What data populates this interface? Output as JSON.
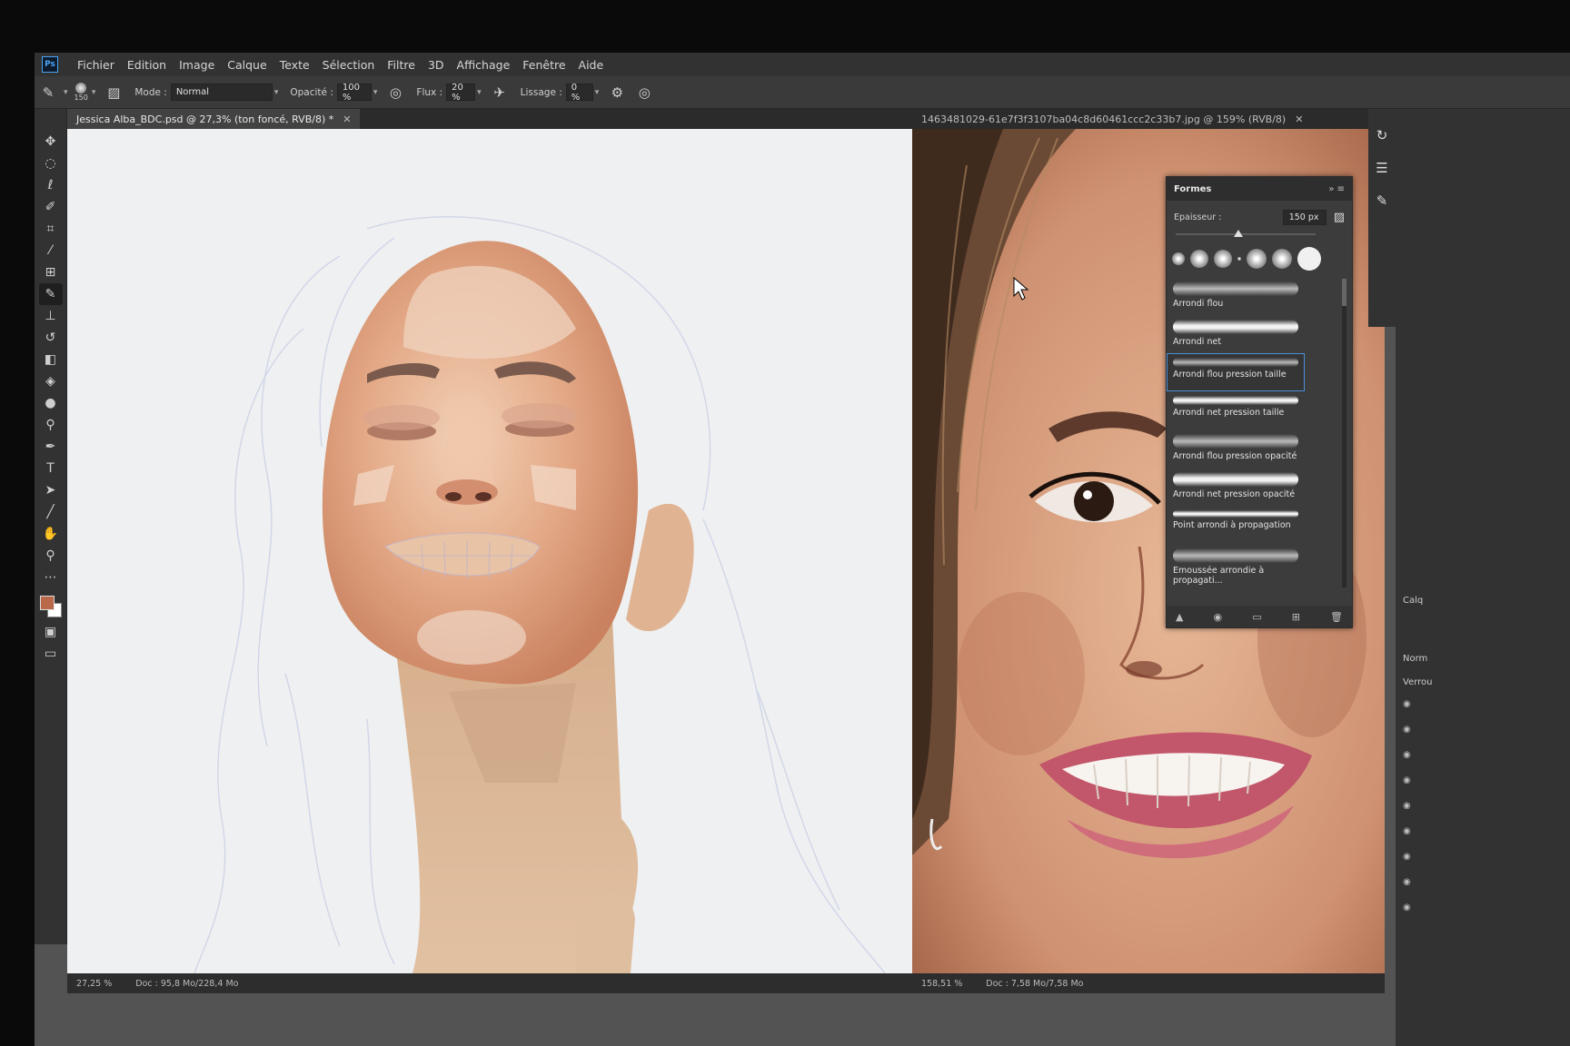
{
  "app": {
    "logo": "Ps",
    "menu": [
      "Fichier",
      "Edition",
      "Image",
      "Calque",
      "Texte",
      "Sélection",
      "Filtre",
      "3D",
      "Affichage",
      "Fenêtre",
      "Aide"
    ]
  },
  "options": {
    "brush_size": "150",
    "mode_label": "Mode :",
    "mode_value": "Normal",
    "opacity_label": "Opacité :",
    "opacity_value": "100 %",
    "flow_label": "Flux :",
    "flow_value": "20 %",
    "smoothing_label": "Lissage :",
    "smoothing_value": "0 %"
  },
  "docs": {
    "left_tab": "Jessica Alba_BDC.psd @ 27,3% (ton foncé, RVB/8) *",
    "right_tab": "1463481029-61e7f3f3107ba04c8d60461ccc2c33b7.jpg @ 159% (RVB/8)"
  },
  "status": {
    "left_zoom": "27,25 %",
    "left_doc": "Doc : 95,8 Mo/228,4 Mo",
    "right_zoom": "158,51 %",
    "right_doc": "Doc : 7,58 Mo/7,58 Mo"
  },
  "formes": {
    "title": "Formes",
    "size_label": "Epaisseur :",
    "size_value": "150 px",
    "size_fraction": 0.45,
    "brushes": [
      "Arrondi flou",
      "Arrondi net",
      "Arrondi flou pression taille",
      "Arrondi net pression taille",
      "Arrondi flou pression opacité",
      "Arrondi net pression opacité",
      "Point arrondi à propagation",
      "Emoussée arrondie à propagati..."
    ],
    "selected_index": 2
  },
  "layers": {
    "title": "Calq",
    "mode_short": "Norm",
    "lock_short": "Verrou"
  },
  "colors": {
    "foreground": "#b9694a",
    "background": "#ffffff",
    "accent": "#4c8fd9"
  },
  "icons": [
    "move-icon",
    "marquee-icon",
    "lasso-icon",
    "quick-select-icon",
    "crop-icon",
    "eyedropper-icon",
    "patch-icon",
    "brush-icon",
    "stamp-icon",
    "history-brush-icon",
    "eraser-icon",
    "bucket-icon",
    "blur-icon",
    "dodge-icon",
    "pen-icon",
    "type-icon",
    "path-select-icon",
    "line-icon",
    "hand-icon",
    "zoom-icon",
    "more-icon"
  ]
}
